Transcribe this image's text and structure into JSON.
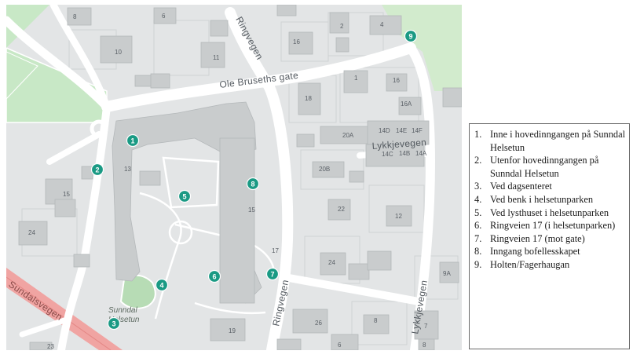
{
  "map": {
    "streets": {
      "ole_bruseths_gate": "Ole Bruseths gate",
      "ringvegen_top": "Ringvegen",
      "ringvegen_bottom": "Ringvegen",
      "lykkjevegen_mid": "Lykkjevegen",
      "lykkjevegen_bottom": "Lykkjevegen",
      "sundalsvegen": "Sundalsvegen"
    },
    "place_label_line1": "Sunndal",
    "place_label_line2": "Helsetun",
    "house_numbers": [
      "8",
      "6",
      "10",
      "11",
      "16",
      "2",
      "4",
      "1",
      "18",
      "16",
      "16A",
      "20A",
      "14D",
      "14E",
      "14F",
      "14C",
      "14B",
      "14A",
      "13",
      "20B",
      "15",
      "22",
      "12",
      "24",
      "15",
      "24",
      "17",
      "26",
      "8",
      "9A",
      "19",
      "23",
      "7",
      "8",
      "6"
    ],
    "markers": [
      "1",
      "2",
      "3",
      "4",
      "5",
      "6",
      "7",
      "8",
      "9"
    ],
    "colors": {
      "marker": "#1a9a84",
      "road": "#ffffff",
      "land": "#e3e5e6",
      "building": "#c9cccd",
      "green": "#c8e8c6",
      "main_road": "#f0a4a2"
    }
  },
  "legend": {
    "items": [
      {
        "n": "1.",
        "text": "Inne i hovedinngangen på Sunndal Helsetun"
      },
      {
        "n": "2.",
        "text": "Utenfor hovedinngangen på Sunndal Helsetun"
      },
      {
        "n": "3.",
        "text": "Ved dagsenteret"
      },
      {
        "n": "4.",
        "text": "Ved benk i helsetunparken"
      },
      {
        "n": "5.",
        "text": "Ved lysthuset i helsetunparken"
      },
      {
        "n": "6.",
        "text": "Ringveien 17 (i helsetunparken)"
      },
      {
        "n": "7.",
        "text": "Ringveien 17 (mot gate)"
      },
      {
        "n": "8.",
        "text": "Inngang bofellesskapet"
      },
      {
        "n": "9.",
        "text": "Holten/Fagerhaugan"
      }
    ]
  }
}
